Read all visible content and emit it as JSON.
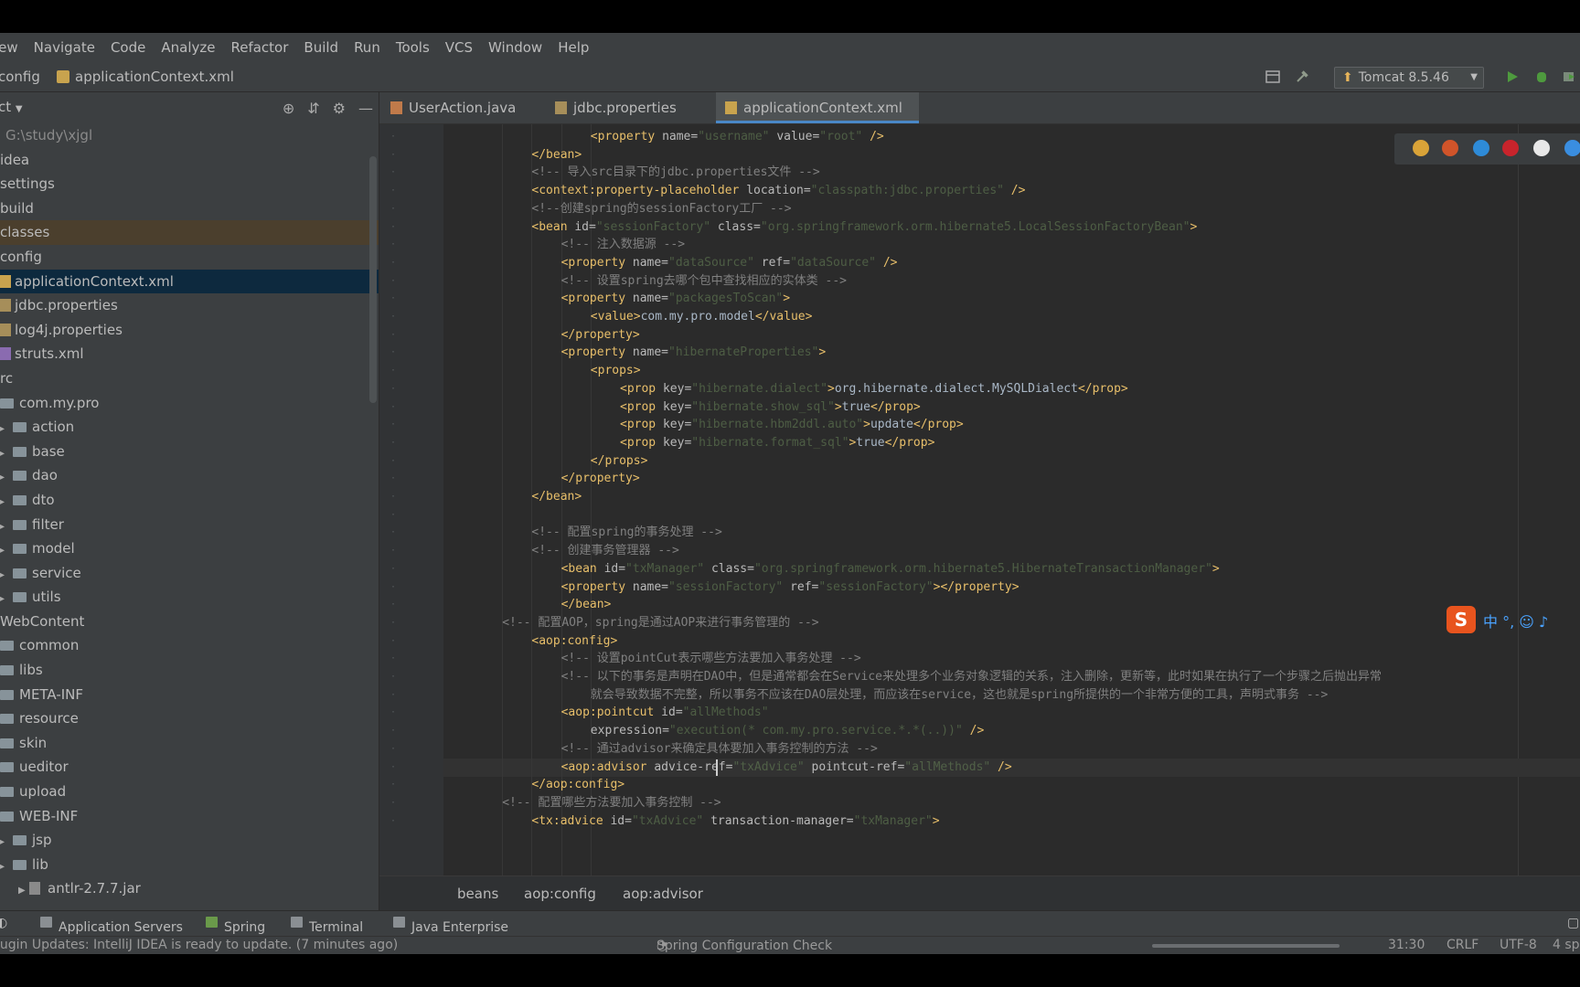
{
  "menu": [
    "iew",
    "Navigate",
    "Code",
    "Analyze",
    "Refactor",
    "Build",
    "Run",
    "Tools",
    "VCS",
    "Window",
    "Help"
  ],
  "nav": {
    "crumb_folder": "config",
    "crumb_file": "applicationContext.xml",
    "run_config": "Tomcat 8.5.46"
  },
  "project": {
    "title": "ct",
    "items": [
      {
        "label": "G:\\study\\xjgl",
        "kind": "path"
      },
      {
        "label": "idea",
        "kind": "plain"
      },
      {
        "label": "settings",
        "kind": "plain"
      },
      {
        "label": "build",
        "kind": "plain"
      },
      {
        "label": "classes",
        "kind": "hl"
      },
      {
        "label": "config",
        "kind": "plain"
      },
      {
        "label": "applicationContext.xml",
        "kind": "sel"
      },
      {
        "label": "jdbc.properties",
        "kind": "file"
      },
      {
        "label": "log4j.properties",
        "kind": "file"
      },
      {
        "label": "struts.xml",
        "kind": "file"
      },
      {
        "label": "rc",
        "kind": "plain"
      },
      {
        "label": "com.my.pro",
        "kind": "pkg"
      },
      {
        "label": "action",
        "kind": "folder"
      },
      {
        "label": "base",
        "kind": "folder"
      },
      {
        "label": "dao",
        "kind": "folder"
      },
      {
        "label": "dto",
        "kind": "folder"
      },
      {
        "label": "filter",
        "kind": "folder"
      },
      {
        "label": "model",
        "kind": "folder"
      },
      {
        "label": "service",
        "kind": "folder"
      },
      {
        "label": "utils",
        "kind": "folder"
      },
      {
        "label": "WebContent",
        "kind": "plain"
      },
      {
        "label": "common",
        "kind": "folder2"
      },
      {
        "label": "libs",
        "kind": "folder2"
      },
      {
        "label": "META-INF",
        "kind": "folder2"
      },
      {
        "label": "resource",
        "kind": "folder2"
      },
      {
        "label": "skin",
        "kind": "folder2"
      },
      {
        "label": "ueditor",
        "kind": "folder2"
      },
      {
        "label": "upload",
        "kind": "folder2"
      },
      {
        "label": "WEB-INF",
        "kind": "folder2"
      },
      {
        "label": "jsp",
        "kind": "folder3"
      },
      {
        "label": "lib",
        "kind": "folder3"
      },
      {
        "label": "antlr-2.7.7.jar",
        "kind": "jar"
      }
    ]
  },
  "tabs": [
    {
      "label": "UserAction.java"
    },
    {
      "label": "jdbc.properties"
    },
    {
      "label": "applicationContext.xml"
    }
  ],
  "code": [
    {
      "i": 4,
      "parts": [
        [
          "t",
          "<property "
        ],
        [
          "a",
          "name="
        ],
        [
          "v",
          "\"username\""
        ],
        [
          "a",
          " value="
        ],
        [
          "v",
          "\"root\""
        ],
        [
          "t",
          " />"
        ]
      ]
    },
    {
      "i": 2,
      "parts": [
        [
          "t",
          "</bean>"
        ]
      ]
    },
    {
      "i": 2,
      "parts": [
        [
          "c",
          "<!-- 导入src目录下的jdbc.properties文件 -->"
        ]
      ]
    },
    {
      "i": 2,
      "parts": [
        [
          "t",
          "<context:property-placeholder "
        ],
        [
          "a",
          "location="
        ],
        [
          "v",
          "\"classpath:jdbc.properties\""
        ],
        [
          "t",
          " />"
        ]
      ]
    },
    {
      "i": 2,
      "parts": [
        [
          "c",
          "<!--创建spring的sessionFactory工厂 -->"
        ]
      ]
    },
    {
      "i": 2,
      "parts": [
        [
          "t",
          "<bean "
        ],
        [
          "a",
          "id="
        ],
        [
          "v",
          "\"sessionFactory\""
        ],
        [
          "a",
          " class="
        ],
        [
          "v",
          "\"org.springframework.orm.hibernate5.LocalSessionFactoryBean\""
        ],
        [
          "t",
          ">"
        ]
      ]
    },
    {
      "i": 3,
      "parts": [
        [
          "c",
          "<!-- 注入数据源 -->"
        ]
      ]
    },
    {
      "i": 3,
      "parts": [
        [
          "t",
          "<property "
        ],
        [
          "a",
          "name="
        ],
        [
          "v",
          "\"dataSource\""
        ],
        [
          "a",
          " ref="
        ],
        [
          "v",
          "\"dataSource\""
        ],
        [
          "t",
          " />"
        ]
      ]
    },
    {
      "i": 3,
      "parts": [
        [
          "c",
          "<!-- 设置spring去哪个包中查找相应的实体类 -->"
        ]
      ]
    },
    {
      "i": 3,
      "parts": [
        [
          "t",
          "<property "
        ],
        [
          "a",
          "name="
        ],
        [
          "v",
          "\"packagesToScan\""
        ],
        [
          "t",
          ">"
        ]
      ]
    },
    {
      "i": 4,
      "parts": [
        [
          "t",
          "<value>"
        ],
        [
          "x",
          "com.my.pro.model"
        ],
        [
          "t",
          "</value>"
        ]
      ]
    },
    {
      "i": 3,
      "parts": [
        [
          "t",
          "</property>"
        ]
      ]
    },
    {
      "i": 3,
      "parts": [
        [
          "t",
          "<property "
        ],
        [
          "a",
          "name="
        ],
        [
          "v",
          "\"hibernateProperties\""
        ],
        [
          "t",
          ">"
        ]
      ]
    },
    {
      "i": 4,
      "parts": [
        [
          "t",
          "<props>"
        ]
      ]
    },
    {
      "i": 5,
      "parts": [
        [
          "t",
          "<prop "
        ],
        [
          "a",
          "key="
        ],
        [
          "v",
          "\"hibernate.dialect\""
        ],
        [
          "t",
          ">"
        ],
        [
          "x",
          "org.hibernate.dialect.MySQLDialect"
        ],
        [
          "t",
          "</prop>"
        ]
      ]
    },
    {
      "i": 5,
      "parts": [
        [
          "t",
          "<prop "
        ],
        [
          "a",
          "key="
        ],
        [
          "v",
          "\"hibernate.show_sql\""
        ],
        [
          "t",
          ">"
        ],
        [
          "x",
          "true"
        ],
        [
          "t",
          "</prop>"
        ]
      ]
    },
    {
      "i": 5,
      "parts": [
        [
          "t",
          "<prop "
        ],
        [
          "a",
          "key="
        ],
        [
          "v",
          "\"hibernate.hbm2ddl.auto\""
        ],
        [
          "t",
          ">"
        ],
        [
          "x",
          "update"
        ],
        [
          "t",
          "</prop>"
        ]
      ]
    },
    {
      "i": 5,
      "parts": [
        [
          "t",
          "<prop "
        ],
        [
          "a",
          "key="
        ],
        [
          "v",
          "\"hibernate.format_sql\""
        ],
        [
          "t",
          ">"
        ],
        [
          "x",
          "true"
        ],
        [
          "t",
          "</prop>"
        ]
      ]
    },
    {
      "i": 4,
      "parts": [
        [
          "t",
          "</props>"
        ]
      ]
    },
    {
      "i": 3,
      "parts": [
        [
          "t",
          "</property>"
        ]
      ]
    },
    {
      "i": 2,
      "parts": [
        [
          "t",
          "</bean>"
        ]
      ]
    },
    {
      "i": 0,
      "parts": []
    },
    {
      "i": 2,
      "parts": [
        [
          "c",
          "<!-- 配置spring的事务处理 -->"
        ]
      ]
    },
    {
      "i": 2,
      "parts": [
        [
          "c",
          "<!-- 创建事务管理器 -->"
        ]
      ]
    },
    {
      "i": 3,
      "parts": [
        [
          "t",
          "<bean "
        ],
        [
          "a",
          "id="
        ],
        [
          "v",
          "\"txManager\""
        ],
        [
          "a",
          " class="
        ],
        [
          "v",
          "\"org.springframework.orm.hibernate5.HibernateTransactionManager\""
        ],
        [
          "t",
          ">"
        ]
      ]
    },
    {
      "i": 3,
      "parts": [
        [
          "t",
          "<property "
        ],
        [
          "a",
          "name="
        ],
        [
          "v",
          "\"sessionFactory\""
        ],
        [
          "a",
          " ref="
        ],
        [
          "v",
          "\"sessionFactory\""
        ],
        [
          "t",
          "></property>"
        ]
      ]
    },
    {
      "i": 3,
      "parts": [
        [
          "t",
          "</bean>"
        ]
      ]
    },
    {
      "i": 1,
      "parts": [
        [
          "c",
          "<!-- 配置AOP，spring是通过AOP来进行事务管理的 -->"
        ]
      ]
    },
    {
      "i": 2,
      "parts": [
        [
          "t",
          "<aop:config>"
        ]
      ]
    },
    {
      "i": 3,
      "parts": [
        [
          "c",
          "<!-- 设置pointCut表示哪些方法要加入事务处理 -->"
        ]
      ]
    },
    {
      "i": 3,
      "parts": [
        [
          "c",
          "<!-- 以下的事务是声明在DAO中，但是通常都会在Service来处理多个业务对象逻辑的关系，注入删除，更新等，此时如果在执行了一个步骤之后抛出异常"
        ]
      ]
    },
    {
      "i": 4,
      "parts": [
        [
          "c",
          "就会导致数据不完整，所以事务不应该在DAO层处理，而应该在service，这也就是spring所提供的一个非常方便的工具，声明式事务 -->"
        ]
      ]
    },
    {
      "i": 3,
      "parts": [
        [
          "t",
          "<aop:pointcut "
        ],
        [
          "a",
          "id="
        ],
        [
          "v",
          "\"allMethods\""
        ]
      ]
    },
    {
      "i": 4,
      "parts": [
        [
          "a",
          "expression="
        ],
        [
          "v",
          "\"execution(* com.my.pro.service.*.*(..))\""
        ],
        [
          "t",
          " />"
        ]
      ]
    },
    {
      "i": 3,
      "parts": [
        [
          "c",
          "<!-- 通过advisor来确定具体要加入事务控制的方法 -->"
        ]
      ]
    },
    {
      "i": 3,
      "parts": [
        [
          "t",
          "<aop:advisor "
        ],
        [
          "a",
          "advice-ref="
        ],
        [
          "v",
          "\"txAdvice\""
        ],
        [
          "a",
          " pointcut-ref="
        ],
        [
          "v",
          "\"allMethods\""
        ],
        [
          "t",
          " />"
        ]
      ]
    },
    {
      "i": 2,
      "parts": [
        [
          "t",
          "</aop:config>"
        ]
      ]
    },
    {
      "i": 1,
      "parts": [
        [
          "c",
          "<!-- 配置哪些方法要加入事务控制 -->"
        ]
      ]
    },
    {
      "i": 2,
      "parts": [
        [
          "t",
          "<tx:advice "
        ],
        [
          "a",
          "id="
        ],
        [
          "v",
          "\"txAdvice\""
        ],
        [
          "a",
          " transaction-manager="
        ],
        [
          "v",
          "\"txManager\""
        ],
        [
          "t",
          ">"
        ]
      ]
    }
  ],
  "ime": {
    "logo": "S",
    "text": "中 °, ☺ ♪"
  },
  "crumbs": [
    "beans",
    "aop:config",
    "aop:advisor"
  ],
  "toolwindows": [
    "Application Servers",
    "Spring",
    "Terminal",
    "Java Enterprise"
  ],
  "status": {
    "left": "lugin Updates: IntelliJ IDEA is ready to update. (7 minutes ago)",
    "center": "Spring Configuration Check",
    "pos": "31:30",
    "crlf": "CRLF",
    "enc": "UTF-8",
    "indent": "4 sp"
  }
}
